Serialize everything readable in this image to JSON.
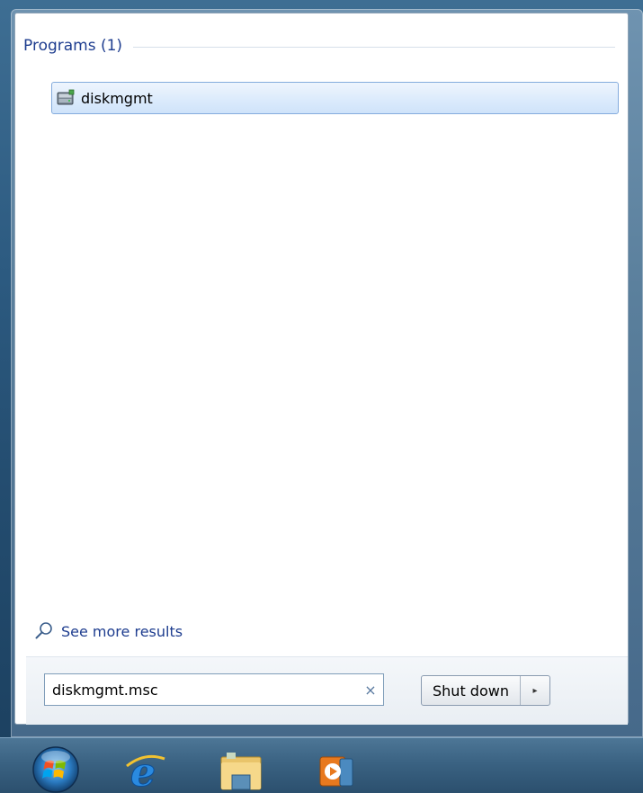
{
  "start_menu": {
    "section_title": "Programs (1)",
    "results": [
      {
        "label": "diskmgmt",
        "icon": "disk-management-icon"
      }
    ],
    "see_more_label": "See more results",
    "search": {
      "value": "diskmgmt.msc",
      "clear_glyph": "×"
    },
    "shutdown": {
      "label": "Shut down",
      "arrow_glyph": "▸"
    }
  },
  "taskbar": {
    "items": [
      {
        "icon": "windows-start-orb"
      },
      {
        "icon": "internet-explorer-icon"
      },
      {
        "icon": "windows-explorer-icon"
      },
      {
        "icon": "windows-media-player-icon"
      }
    ]
  },
  "colors": {
    "link_blue": "#1e3d8f",
    "selection_border": "#84acdd"
  }
}
